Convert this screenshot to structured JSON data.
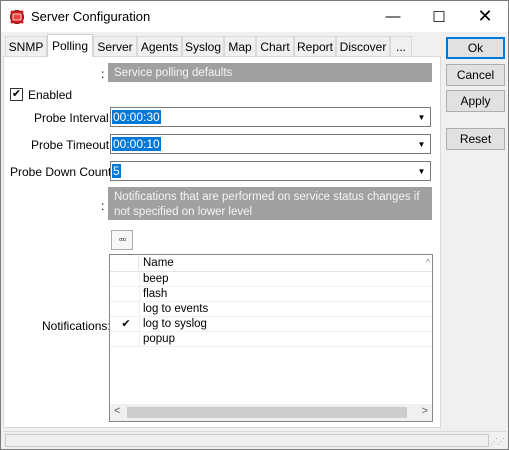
{
  "window": {
    "title": "Server Configuration",
    "minimize": "—",
    "maximize": "☐",
    "close": "✕"
  },
  "tabs": [
    {
      "label": "SNMP"
    },
    {
      "label": "Polling"
    },
    {
      "label": "Server"
    },
    {
      "label": "Agents"
    },
    {
      "label": "Syslog"
    },
    {
      "label": "Map"
    },
    {
      "label": "Chart"
    },
    {
      "label": "Report"
    },
    {
      "label": "Discover"
    },
    {
      "label": "..."
    }
  ],
  "active_tab": "Polling",
  "buttons": {
    "ok": "Ok",
    "cancel": "Cancel",
    "apply": "Apply",
    "reset": "Reset"
  },
  "polling": {
    "section_colon": ":",
    "section_header": "Service polling defaults",
    "enabled_label": "Enabled",
    "enabled_checked": "✔",
    "probe_interval_label": "Probe Interval:",
    "probe_interval_value": "00:00:30",
    "probe_timeout_label": "Probe Timeout:",
    "probe_timeout_value": "00:00:10",
    "probe_down_count_label": "Probe Down Count:",
    "probe_down_count_value": "5",
    "notif_colon": ":",
    "notif_description": "Notifications that are performed on service status changes if not specified on lower level",
    "ellipsis_button": "▫▫▫",
    "notifications_label": "Notifications:",
    "list_header_name": "Name",
    "notifications": [
      {
        "check": "",
        "name": "beep"
      },
      {
        "check": "",
        "name": "flash"
      },
      {
        "check": "",
        "name": "log to events"
      },
      {
        "check": "✔",
        "name": "log to syslog"
      },
      {
        "check": "",
        "name": "popup"
      }
    ]
  },
  "icons": {
    "app": "app-logo-icon",
    "dropdown": "chevron-down-icon"
  },
  "colors": {
    "accent": "#0078d7",
    "section_bar": "#a0a0a0"
  }
}
